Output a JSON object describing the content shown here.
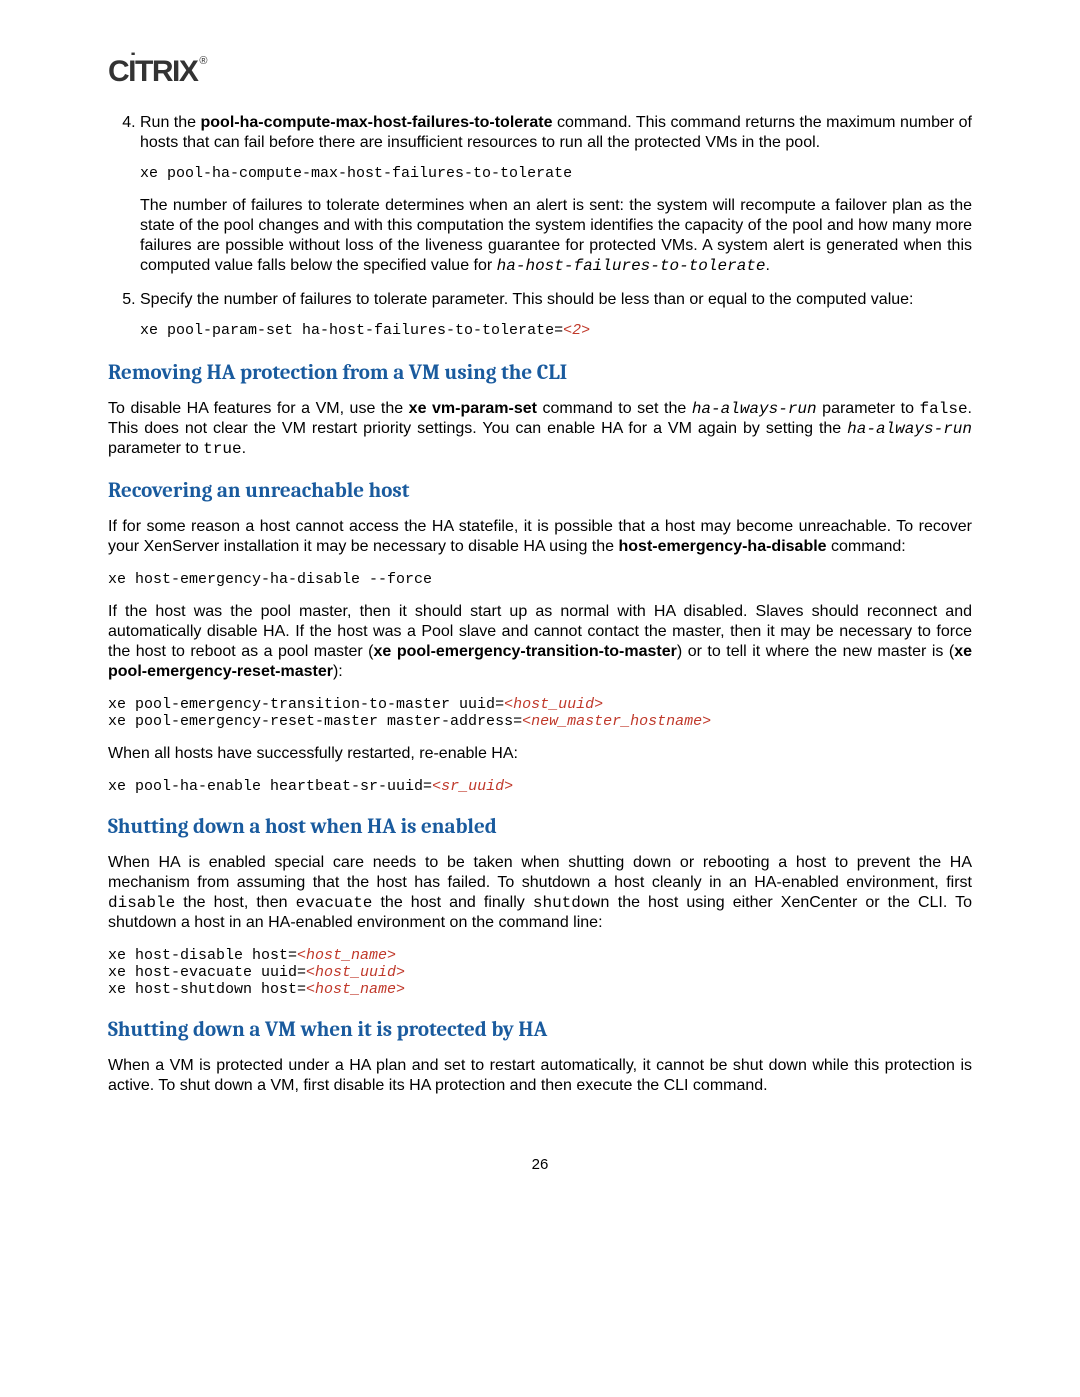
{
  "logo": {
    "text": "CİTRIX",
    "reg": "®"
  },
  "step4": {
    "num": "4.",
    "p1_prefix": "Run the ",
    "p1_cmd": "pool-ha-compute-max-host-failures-to-tolerate",
    "p1_suffix": " command. This command returns the maximum number of hosts that can fail before there are insufficient resources to run all the protected VMs in the pool.",
    "code1": "xe pool-ha-compute-max-host-failures-to-tolerate",
    "p2_prefix": "The number of failures to tolerate determines when an alert is sent: the system will recompute a failover plan as the state of the pool changes and with this computation the system identifies the capacity of the pool and how many more failures are possible without loss of the liveness guarantee for protected VMs. A system alert is generated when this computed value falls below the specified value for ",
    "p2_param": "ha-host-failures-to-tolerate",
    "p2_suffix": "."
  },
  "step5": {
    "num": "5.",
    "p1": "Specify the number of failures to tolerate parameter. This should be less than or equal to the computed value:",
    "code_pre": "xe pool-param-set ha-host-failures-to-tolerate=",
    "code_ph": "<2>"
  },
  "sec1": {
    "title": "Removing HA protection from a VM using the CLI",
    "p1_a": "To disable HA features for a VM, use the ",
    "p1_cmd": "xe vm-param-set",
    "p1_b": " command to set the ",
    "p1_param1": "ha-always-run",
    "p1_c": " parameter to ",
    "p1_false": "false",
    "p1_d": ". This does not clear the VM restart priority settings. You can enable HA for a VM again by setting the ",
    "p1_param2": "ha-always-run",
    "p1_e": " parameter to ",
    "p1_true": "true",
    "p1_f": "."
  },
  "sec2": {
    "title": "Recovering an unreachable host",
    "p1_a": "If for some reason a host cannot access the HA statefile, it is possible that a host may become unreachable. To recover your XenServer installation it may be necessary to disable HA using the ",
    "p1_cmd": "host-emergency-ha-disable",
    "p1_b": " command:",
    "code1": "xe host-emergency-ha-disable --force",
    "p2_a": "If the host was the pool master, then it should start up as normal with HA disabled. Slaves should reconnect and automatically disable HA. If the host was a Pool slave and cannot contact the master, then it may be necessary to force the host to reboot as a pool master (",
    "p2_cmd1": "xe pool-emergency-transition-to-master",
    "p2_b": ") or to tell it where the new master is (",
    "p2_cmd2": "xe pool-emergency-reset-master",
    "p2_c": "):",
    "code2a_pre": "xe pool-emergency-transition-to-master uuid=",
    "code2a_ph": "<host_uuid>",
    "code2b_pre": "xe pool-emergency-reset-master master-address=",
    "code2b_ph": "<new_master_hostname>",
    "p3": "When all hosts have successfully restarted, re-enable HA:",
    "code3_pre": "xe pool-ha-enable heartbeat-sr-uuid=",
    "code3_ph": "<sr_uuid>"
  },
  "sec3": {
    "title": "Shutting down a host when HA is enabled",
    "p1_a": "When HA is enabled special care needs to be taken when shutting down or rebooting a host to prevent the HA mechanism from assuming that the host has failed. To shutdown a host cleanly in an HA-enabled environment, first ",
    "p1_disable": "disable",
    "p1_b": " the host, then ",
    "p1_evacuate": "evacuate",
    "p1_c": " the host and finally ",
    "p1_shutdown": "shutdown",
    "p1_d": " the host using either XenCenter or the CLI. To shutdown a host in an HA-enabled environment on the command line:",
    "code1a_pre": "xe host-disable host=",
    "code1a_ph": "<host_name>",
    "code1b_pre": "xe host-evacuate uuid=",
    "code1b_ph": "<host_uuid>",
    "code1c_pre": "xe host-shutdown host=",
    "code1c_ph": "<host_name>"
  },
  "sec4": {
    "title": "Shutting down a VM when it is protected by HA",
    "p1": "When a VM is protected under a HA plan and set to restart automatically, it cannot be shut down while this protection is active. To shut down a VM, first disable its HA protection and then execute the CLI command."
  },
  "pagenum": "26"
}
